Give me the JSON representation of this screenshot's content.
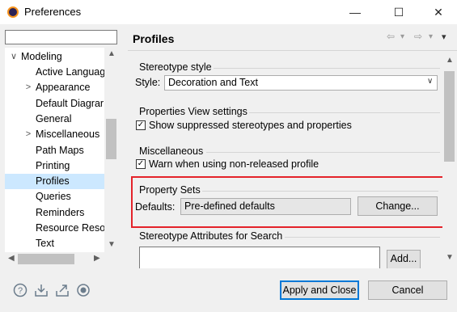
{
  "window": {
    "title": "Preferences",
    "minimize": "—",
    "maximize": "☐",
    "close": "✕"
  },
  "filter": {
    "value": "",
    "placeholder": ""
  },
  "tree": {
    "root": {
      "label": "Modeling",
      "twisty": "∨"
    },
    "items": [
      {
        "label": "Active Languag",
        "twisty": ""
      },
      {
        "label": "Appearance",
        "twisty": ">"
      },
      {
        "label": "Default Diagrar",
        "twisty": ""
      },
      {
        "label": "General",
        "twisty": ""
      },
      {
        "label": "Miscellaneous",
        "twisty": ">"
      },
      {
        "label": "Path Maps",
        "twisty": ""
      },
      {
        "label": "Printing",
        "twisty": ""
      },
      {
        "label": "Profiles",
        "twisty": "",
        "selected": true
      },
      {
        "label": "Queries",
        "twisty": ""
      },
      {
        "label": "Reminders",
        "twisty": ""
      },
      {
        "label": "Resource Resol",
        "twisty": ""
      },
      {
        "label": "Text",
        "twisty": ""
      }
    ]
  },
  "page": {
    "title": "Profiles"
  },
  "nav": {
    "back": "⇦",
    "back_menu": "▾",
    "forward": "⇨",
    "forward_menu": "▾",
    "view_menu": "▾"
  },
  "stereotype_style": {
    "group": "Stereotype style",
    "style_label": "Style:",
    "style_value": "Decoration and Text"
  },
  "properties_view": {
    "group": "Properties View settings",
    "checkbox_label": "Show suppressed stereotypes and properties",
    "checked": true
  },
  "miscellaneous": {
    "group": "Miscellaneous",
    "checkbox_label": "Warn when using non-released profile",
    "checked": true
  },
  "property_sets": {
    "group": "Property Sets",
    "defaults_label": "Defaults:",
    "defaults_value": "Pre-defined defaults",
    "change_button": "Change..."
  },
  "stereotype_attributes": {
    "group": "Stereotype Attributes for Search",
    "add_button": "Add..."
  },
  "footer": {
    "apply_close": "Apply and Close",
    "cancel": "Cancel",
    "icons": [
      "help-icon",
      "import-icon",
      "export-icon",
      "record-icon"
    ]
  },
  "colors": {
    "highlight": "#e4232a",
    "selection": "#cce8ff"
  }
}
